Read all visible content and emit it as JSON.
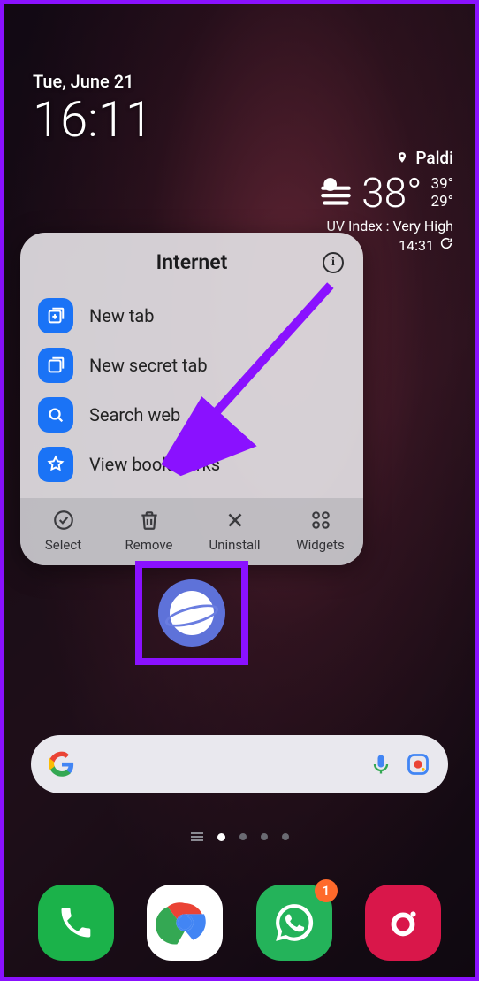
{
  "datetime": {
    "date": "Tue, June 21",
    "time": "16:11"
  },
  "weather": {
    "location": "Paldi",
    "temp": "38°",
    "high": "39°",
    "low": "29°",
    "uv_label": "UV Index : Very High",
    "updated": "14:31"
  },
  "popup": {
    "title": "Internet",
    "shortcuts": [
      {
        "label": "New tab",
        "icon": "new-tab-icon"
      },
      {
        "label": "New secret tab",
        "icon": "secret-tab-icon"
      },
      {
        "label": "Search web",
        "icon": "search-icon"
      },
      {
        "label": "View bookmarks",
        "icon": "bookmark-icon"
      }
    ],
    "actions": [
      {
        "label": "Select",
        "icon": "select-icon"
      },
      {
        "label": "Remove",
        "icon": "trash-icon"
      },
      {
        "label": "Uninstall",
        "icon": "close-icon"
      },
      {
        "label": "Widgets",
        "icon": "widgets-icon"
      }
    ]
  },
  "annotation": {
    "arrow_color": "#8a11ff",
    "highlight_target": "uninstall"
  },
  "highlighted_app": {
    "name": "Samsung Internet"
  },
  "pager": {
    "pages": 5,
    "active": 1
  },
  "dock": {
    "apps": [
      {
        "name": "Phone",
        "icon": "phone-icon",
        "badge": null
      },
      {
        "name": "Chrome",
        "icon": "chrome-icon",
        "badge": null
      },
      {
        "name": "WhatsApp",
        "icon": "whatsapp-icon",
        "badge": "1"
      },
      {
        "name": "Camera",
        "icon": "camera-icon",
        "badge": null
      }
    ]
  }
}
